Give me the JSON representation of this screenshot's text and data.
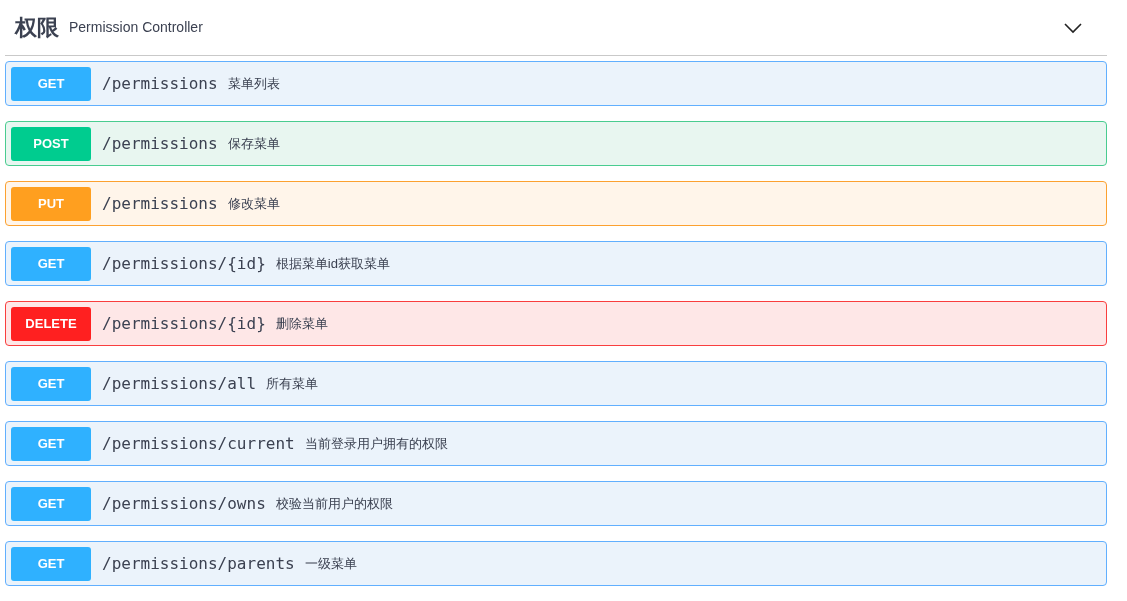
{
  "section": {
    "title": "权限",
    "subtitle": "Permission Controller",
    "expanded": true
  },
  "operations": [
    {
      "kind": "get",
      "method": "GET",
      "path": "/permissions",
      "summary": "菜单列表"
    },
    {
      "kind": "post",
      "method": "POST",
      "path": "/permissions",
      "summary": "保存菜单"
    },
    {
      "kind": "put",
      "method": "PUT",
      "path": "/permissions",
      "summary": "修改菜单"
    },
    {
      "kind": "get",
      "method": "GET",
      "path": "/permissions/{id}",
      "summary": "根据菜单id获取菜单"
    },
    {
      "kind": "delete",
      "method": "DELETE",
      "path": "/permissions/{id}",
      "summary": "删除菜单"
    },
    {
      "kind": "get",
      "method": "GET",
      "path": "/permissions/all",
      "summary": "所有菜单"
    },
    {
      "kind": "get",
      "method": "GET",
      "path": "/permissions/current",
      "summary": "当前登录用户拥有的权限"
    },
    {
      "kind": "get",
      "method": "GET",
      "path": "/permissions/owns",
      "summary": "校验当前用户的权限"
    },
    {
      "kind": "get",
      "method": "GET",
      "path": "/permissions/parents",
      "summary": "一级菜单"
    }
  ]
}
